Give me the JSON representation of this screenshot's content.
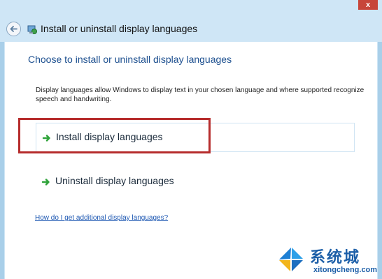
{
  "window": {
    "close_label": "x"
  },
  "nav": {
    "title": "Install or uninstall display languages"
  },
  "main": {
    "heading": "Choose to install or uninstall display languages",
    "description": "Display languages allow Windows to display text in your chosen language and where supported recognize speech and handwriting.",
    "options": [
      {
        "label": "Install display languages"
      },
      {
        "label": "Uninstall display languages"
      }
    ],
    "help_link": "How do I get additional display languages?"
  },
  "watermark": {
    "name": "系统城",
    "url": "xitongcheng.com"
  },
  "colors": {
    "highlight": "#b62c2c",
    "heading": "#1c4f8f",
    "link": "#1c57b2",
    "arrow": "#2fa33a",
    "frame": "#cfe6f6"
  },
  "icons": {
    "back": "back-arrow-icon",
    "control_panel": "control-panel-icon",
    "option_arrow": "green-arrow-icon",
    "watermark_logo": "windows-logo-icon"
  }
}
